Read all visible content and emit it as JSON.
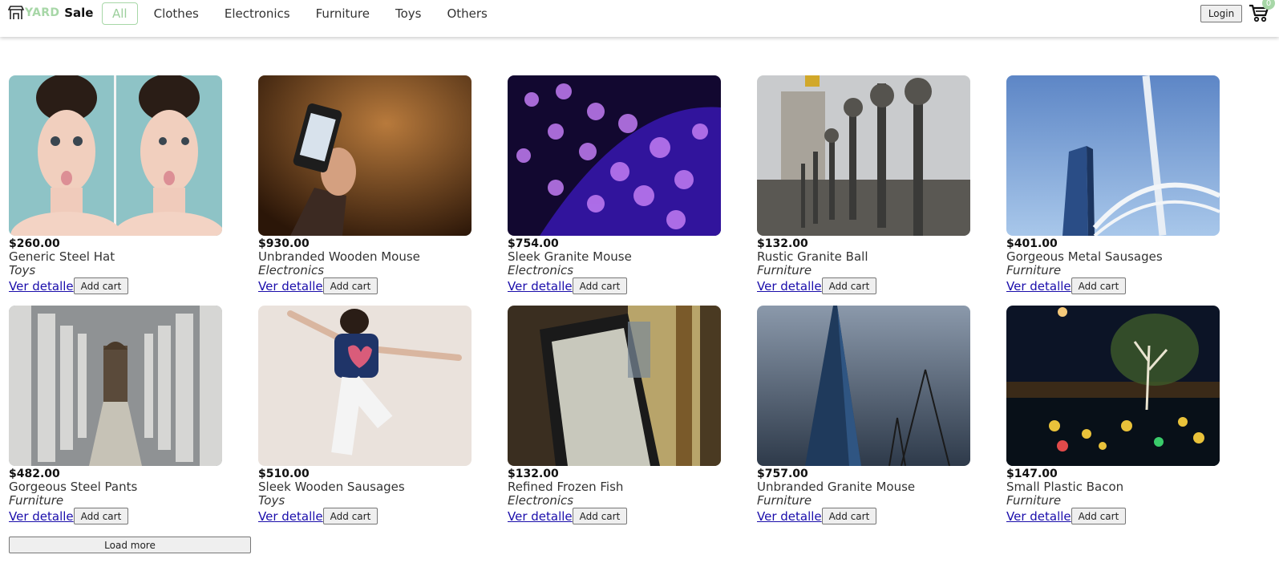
{
  "header": {
    "logo_yard": "YARD",
    "logo_sale": "Sale",
    "nav": [
      "All",
      "Clothes",
      "Electronics",
      "Furniture",
      "Toys",
      "Others"
    ],
    "login_label": "Login",
    "cart_count": "0"
  },
  "products": [
    {
      "price": "$260.00",
      "name": "Generic Steel Hat",
      "category": "Toys",
      "detail_label": "Ver detalle",
      "cart_label": "Add cart"
    },
    {
      "price": "$930.00",
      "name": "Unbranded Wooden Mouse",
      "category": "Electronics",
      "detail_label": "Ver detalle",
      "cart_label": "Add cart"
    },
    {
      "price": "$754.00",
      "name": "Sleek Granite Mouse",
      "category": "Electronics",
      "detail_label": "Ver detalle",
      "cart_label": "Add cart"
    },
    {
      "price": "$132.00",
      "name": "Rustic Granite Ball",
      "category": "Furniture",
      "detail_label": "Ver detalle",
      "cart_label": "Add cart"
    },
    {
      "price": "$401.00",
      "name": "Gorgeous Metal Sausages",
      "category": "Furniture",
      "detail_label": "Ver detalle",
      "cart_label": "Add cart"
    },
    {
      "price": "$482.00",
      "name": "Gorgeous Steel Pants",
      "category": "Furniture",
      "detail_label": "Ver detalle",
      "cart_label": "Add cart"
    },
    {
      "price": "$510.00",
      "name": "Sleek Wooden Sausages",
      "category": "Toys",
      "detail_label": "Ver detalle",
      "cart_label": "Add cart"
    },
    {
      "price": "$132.00",
      "name": "Refined Frozen Fish",
      "category": "Electronics",
      "detail_label": "Ver detalle",
      "cart_label": "Add cart"
    },
    {
      "price": "$757.00",
      "name": "Unbranded Granite Mouse",
      "category": "Furniture",
      "detail_label": "Ver detalle",
      "cart_label": "Add cart"
    },
    {
      "price": "$147.00",
      "name": "Small Plastic Bacon",
      "category": "Furniture",
      "detail_label": "Ver detalle",
      "cart_label": "Add cart"
    }
  ],
  "load_more_label": "Load more",
  "colors": {
    "accent": "#a7d7a7",
    "link": "#1a0dab"
  }
}
